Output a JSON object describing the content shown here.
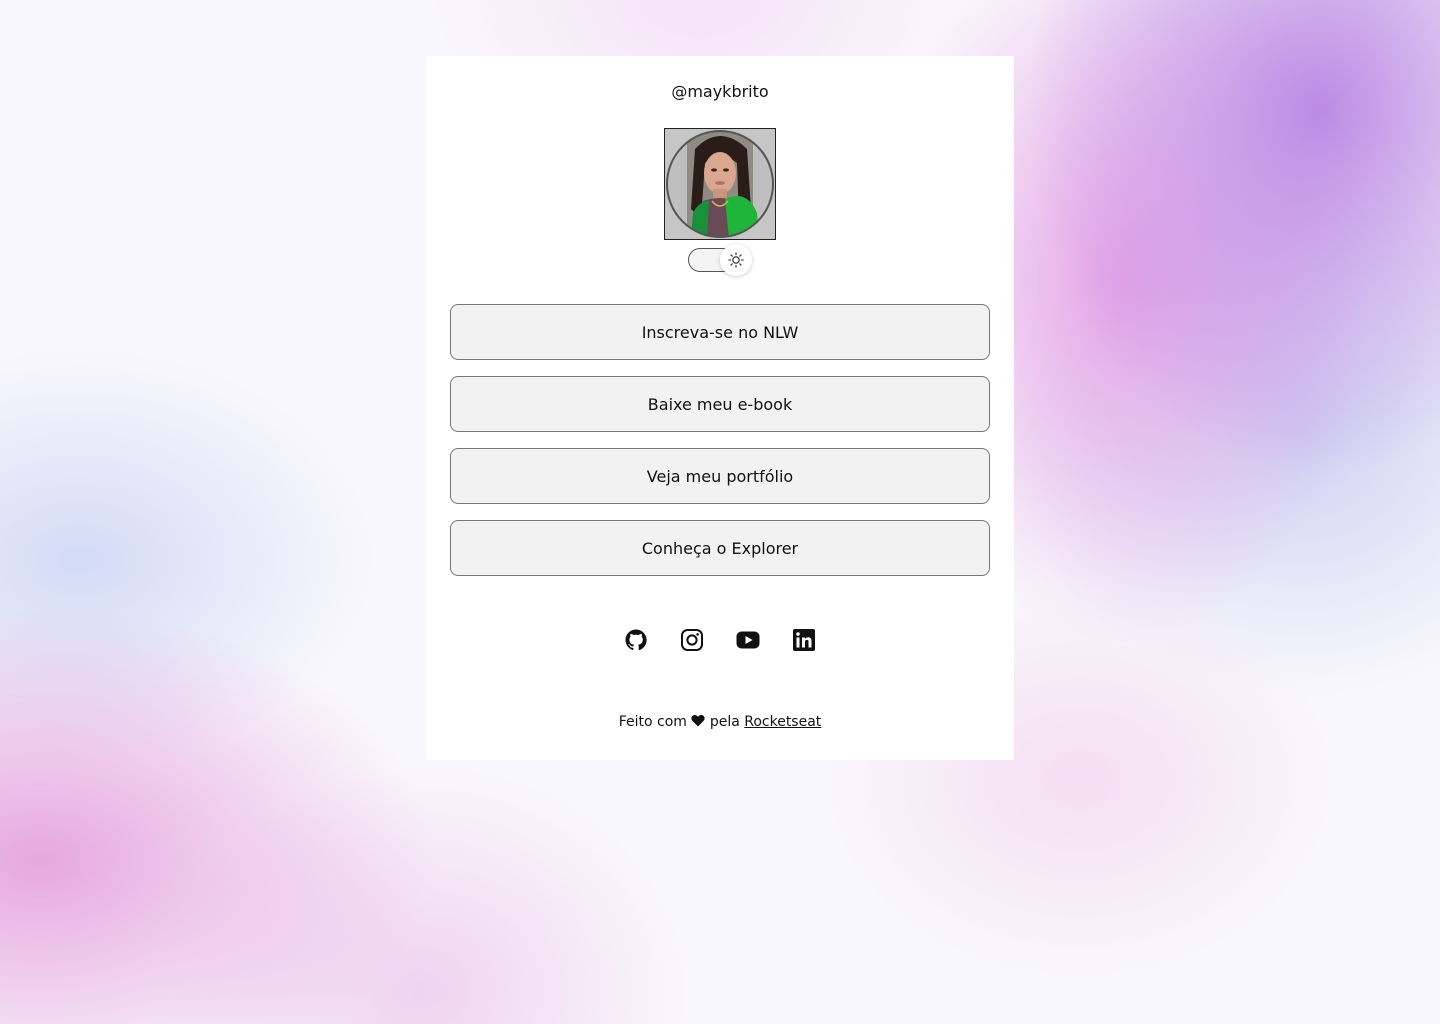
{
  "profile": {
    "handle": "@maykbrito",
    "avatar_alt": "Foto de perfil"
  },
  "theme_toggle": {
    "icon": "sun-icon",
    "state": "light"
  },
  "links": [
    {
      "label": "Inscreva-se no NLW"
    },
    {
      "label": "Baixe meu e-book"
    },
    {
      "label": "Veja meu portfólio"
    },
    {
      "label": "Conheça o Explorer"
    }
  ],
  "social": [
    {
      "icon": "github-icon"
    },
    {
      "icon": "instagram-icon"
    },
    {
      "icon": "youtube-icon"
    },
    {
      "icon": "linkedin-icon"
    }
  ],
  "footer": {
    "prefix": "Feito com",
    "middle": "pela",
    "link_text": "Rocketseat"
  },
  "colors": {
    "card": "#ffffff",
    "button_bg": "#f2f2f2",
    "text": "#111111",
    "accent_pink": "#e18ce1",
    "accent_purple": "#b278e1"
  }
}
